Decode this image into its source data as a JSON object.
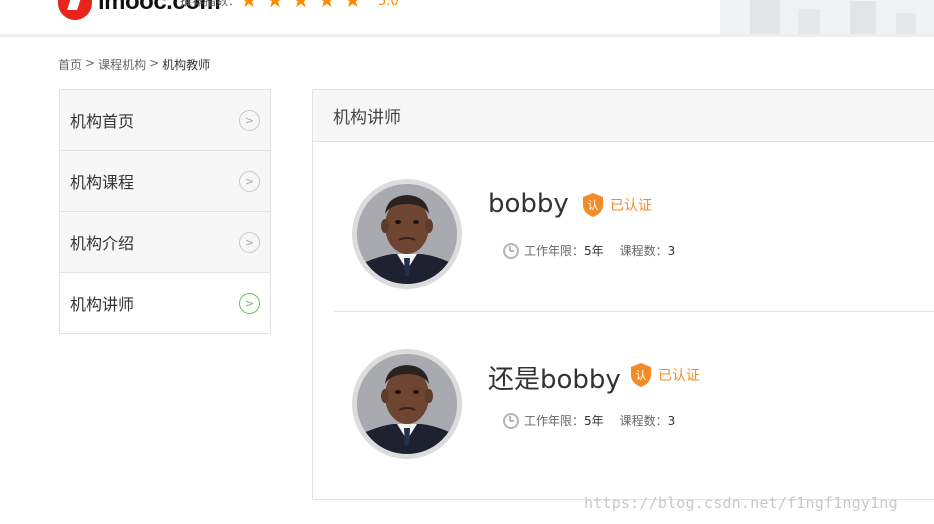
{
  "header": {
    "logo_text": "imooc.com",
    "rating_label": "推荐指数：",
    "rating_stars": 5,
    "rating_value": "5.0",
    "star_color": "#ff8a00"
  },
  "breadcrumb": {
    "items": [
      "首页",
      "课程机构",
      "机构教师"
    ],
    "separator": ">"
  },
  "sidebar": {
    "items": [
      {
        "label": "机构首页",
        "active": false
      },
      {
        "label": "机构课程",
        "active": false
      },
      {
        "label": "机构介绍",
        "active": false
      },
      {
        "label": "机构讲师",
        "active": true
      }
    ],
    "arrow_icon": "chevron-right-icon"
  },
  "panel": {
    "title": "机构讲师",
    "teachers": [
      {
        "name": "bobby",
        "verified_label": "已认证",
        "shield_char": "认",
        "work_years_label": "工作年限：",
        "work_years_value": "5年",
        "course_count_label": "课程数：",
        "course_count_value": "3"
      },
      {
        "name": "还是bobby",
        "verified_label": "已认证",
        "shield_char": "认",
        "work_years_label": "工作年限：",
        "work_years_value": "5年",
        "course_count_label": "课程数：",
        "course_count_value": "3"
      }
    ]
  },
  "watermark": "https://blog.csdn.net/f1ngf1ngy1ng",
  "colors": {
    "accent_orange": "#f28c2a",
    "active_green": "#5fc35f",
    "logo_red": "#e8251c"
  }
}
